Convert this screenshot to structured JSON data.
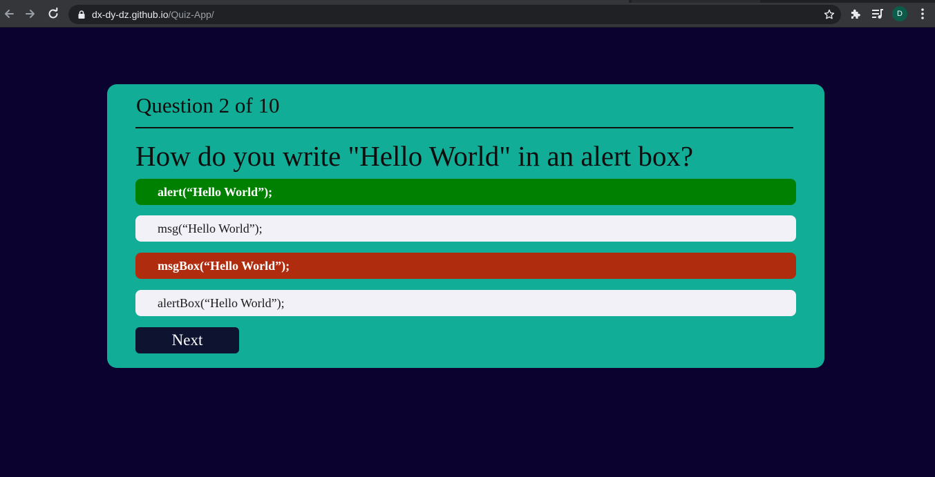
{
  "browser": {
    "url_host": "dx-dy-dz.github.io",
    "url_path": "/Quiz-App/",
    "avatar_letter": "D",
    "icons": [
      "back-arrow-icon",
      "forward-arrow-icon",
      "reload-icon",
      "lock-icon",
      "star-icon",
      "extensions-puzzle-icon",
      "media-queue-icon",
      "more-vertical-icon"
    ]
  },
  "quiz": {
    "counter": "Question 2 of 10",
    "question": "How do you write \"Hello World\" in an alert box?",
    "answers": [
      {
        "text": "alert(“Hello World”);",
        "state": "correct"
      },
      {
        "text": "msg(“Hello World”);",
        "state": "neutral"
      },
      {
        "text": "msgBox(“Hello World”);",
        "state": "incorrect"
      },
      {
        "text": "alertBox(“Hello World”);",
        "state": "neutral"
      }
    ],
    "next_label": "Next"
  },
  "colors": {
    "page_background": "#0b0230",
    "card_background": "#12ad96",
    "correct": "#008000",
    "incorrect": "#b02c0f",
    "neutral": "#f2f1f8",
    "next_button": "#0e1330"
  }
}
